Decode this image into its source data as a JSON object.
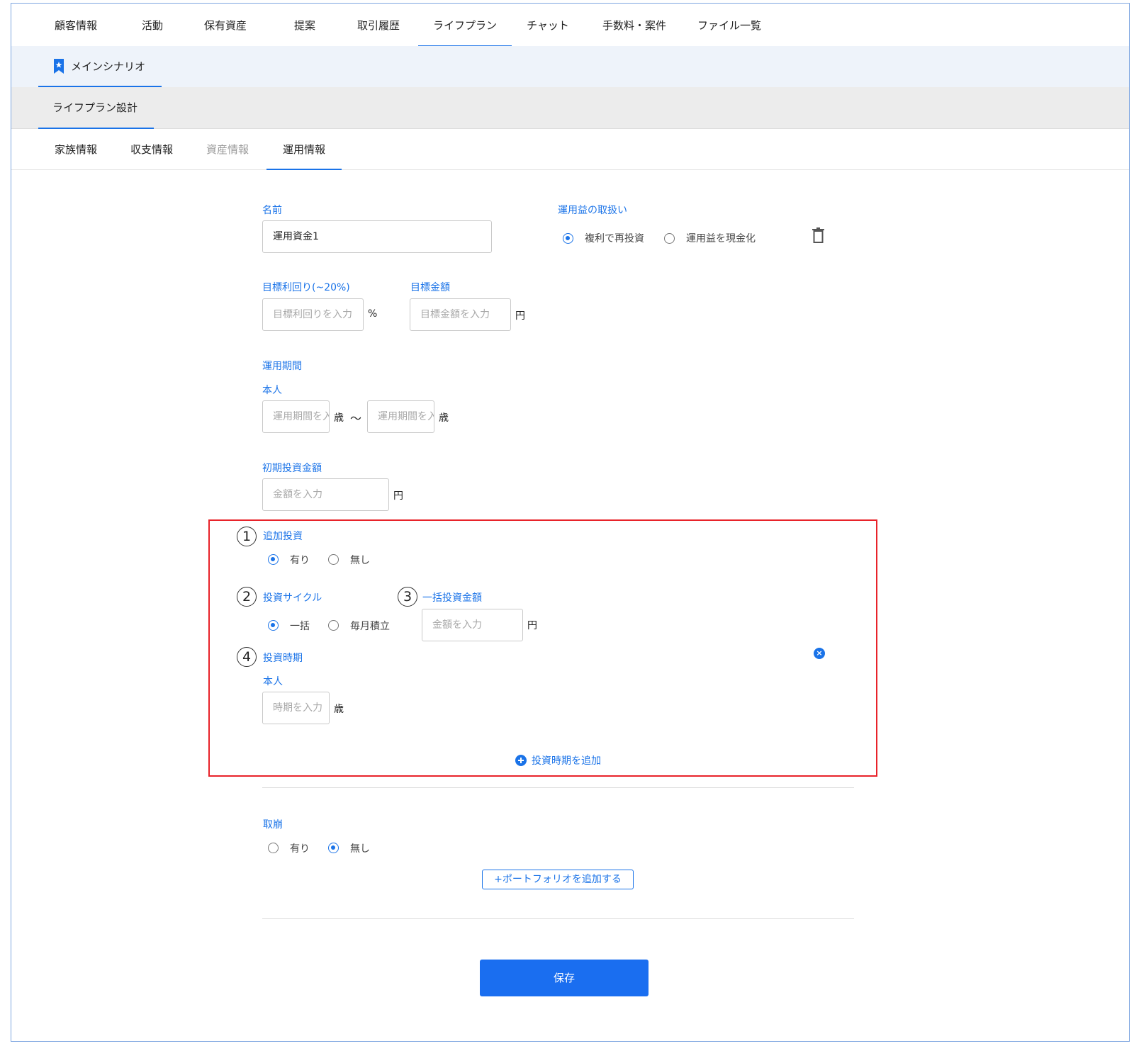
{
  "top_tabs": [
    "顧客情報",
    "活動",
    "保有資産",
    "提案",
    "取引履歴",
    "ライフプラン",
    "チャット",
    "手数料・案件",
    "ファイル一覧"
  ],
  "scenario": {
    "label": "メインシナリオ"
  },
  "design": {
    "label": "ライフプラン設計"
  },
  "sub_tabs": [
    "家族情報",
    "収支情報",
    "資産情報",
    "運用情報"
  ],
  "form": {
    "name_label": "名前",
    "name_value": "運用資金1",
    "profit_label": "運用益の取扱い",
    "profit_options": [
      "複利で再投資",
      "運用益を現金化"
    ],
    "target_rate_label": "目標利回り(~20%)",
    "target_rate_placeholder": "目標利回りを入力",
    "target_rate_unit": "%",
    "target_amount_label": "目標金額",
    "target_amount_placeholder": "目標金額を入力",
    "yen": "円",
    "period_label": "運用期間",
    "self_label": "本人",
    "period_placeholder": "運用期間を入力",
    "age_unit": "歳",
    "tilde": "〜",
    "initial_label": "初期投資金額",
    "amount_placeholder": "金額を入力",
    "additional_label": "追加投資",
    "yes": "有り",
    "no": "無し",
    "cycle_label": "投資サイクル",
    "cycle_options": [
      "一括",
      "毎月積立"
    ],
    "lump_label": "一括投資金額",
    "timing_label": "投資時期",
    "timing_placeholder": "時期を入力",
    "add_timing": "投資時期を追加",
    "withdraw_label": "取崩",
    "add_portfolio": "+ポートフォリオを追加する",
    "save": "保存"
  },
  "annotations": [
    "1",
    "2",
    "3",
    "4"
  ],
  "colors": {
    "accent": "#1a73e8",
    "highlight": "#e8232a",
    "save": "#1a6ef0"
  }
}
